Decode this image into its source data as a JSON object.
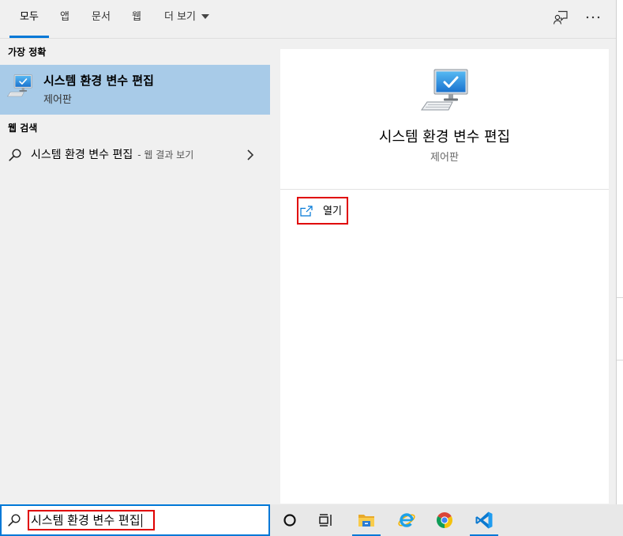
{
  "tabs": [
    {
      "label": "모두",
      "selected": true
    },
    {
      "label": "앱",
      "selected": false
    },
    {
      "label": "문서",
      "selected": false
    },
    {
      "label": "웹",
      "selected": false
    },
    {
      "label": "더 보기",
      "selected": false,
      "icon": "chevron-down-icon"
    }
  ],
  "toolbar_icons": [
    "feedback-icon",
    "more-options-icon"
  ],
  "best_match": {
    "heading": "가장 정확",
    "title": "시스템 환경 변수 편집",
    "subtitle": "제어판",
    "icon": "system-settings-icon",
    "selected": true
  },
  "web_search": {
    "heading": "웹 검색",
    "query": "시스템 환경 변수 편집",
    "suffix": "- 웹 결과 보기",
    "icon": "search-icon",
    "trailing_icon": "chevron-right-icon"
  },
  "detail": {
    "icon": "system-settings-icon",
    "title": "시스템 환경 변수 편집",
    "subtitle": "제어판",
    "actions": [
      {
        "label": "열기",
        "icon": "open-icon",
        "annotated": true
      }
    ]
  },
  "search_box": {
    "icon": "search-icon",
    "value": "시스템 환경 변수 편집",
    "annotated": true
  },
  "taskbar": {
    "items": [
      {
        "icon": "cortana-icon",
        "running": false
      },
      {
        "icon": "task-view-icon",
        "running": false
      },
      {
        "icon": "file-explorer-icon",
        "running": true
      },
      {
        "icon": "internet-explorer-icon",
        "running": false
      },
      {
        "icon": "chrome-icon",
        "running": false
      },
      {
        "icon": "vscode-icon",
        "running": true
      }
    ]
  },
  "colors": {
    "accent": "#0078d7",
    "selection": "#a8cbe8",
    "annotation": "#e00000",
    "panel": "#f0f0f0",
    "card": "#ffffff",
    "taskbar": "#e8e8e8"
  }
}
